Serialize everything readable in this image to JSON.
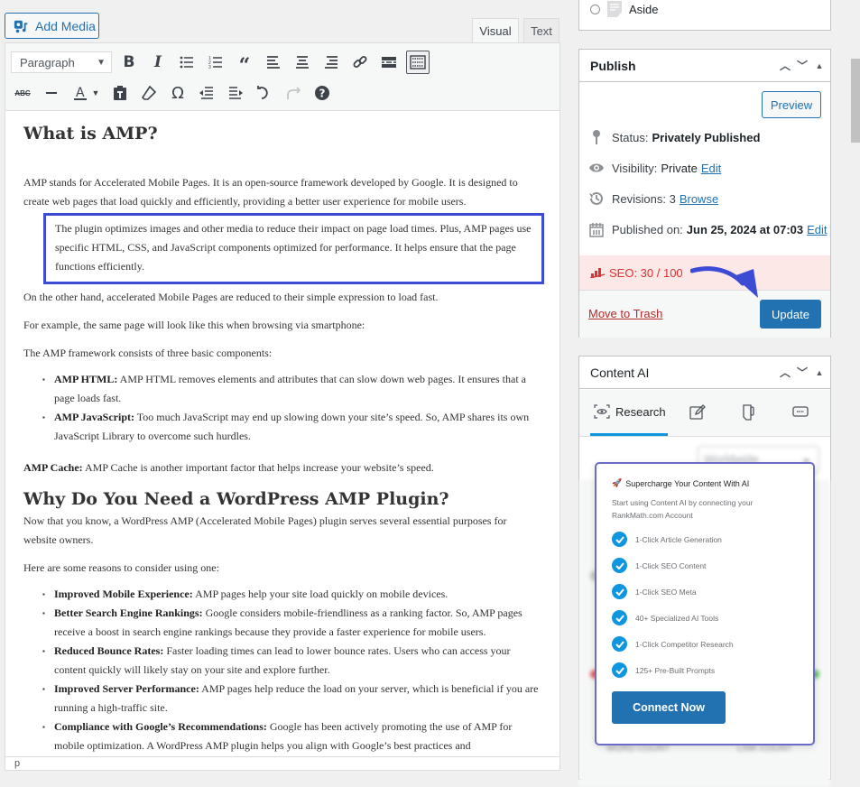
{
  "toolbar": {
    "add_media": "Add Media",
    "tab_visual": "Visual",
    "tab_text": "Text",
    "format_select": "Paragraph",
    "row1_buttons": [
      "bold-icon",
      "italic-icon",
      "bullet-list-icon",
      "numbered-list-icon",
      "blockquote-icon",
      "align-left-icon",
      "align-center-icon",
      "align-right-icon",
      "link-icon",
      "read-more-icon",
      "toolbar-toggle-icon"
    ],
    "row2_buttons": [
      "strikethrough-icon",
      "horizontal-line-icon",
      "text-color-icon",
      "paste-text-icon",
      "clear-formatting-icon",
      "special-character-icon",
      "outdent-icon",
      "indent-icon",
      "undo-icon",
      "redo-icon",
      "help-icon"
    ]
  },
  "content": {
    "h1": "What is AMP?",
    "p1": "AMP stands for Accelerated Mobile Pages. It is an open-source framework developed by Google. It is designed to create web pages that load quickly and efficiently, providing a better user experience for mobile users.",
    "highlight": "The plugin optimizes images and other media to reduce their impact on page load times. Plus, AMP pages use specific HTML, CSS, and JavaScript components optimized for performance. It helps ensure that the page functions efficiently.",
    "p2": "On the other hand, accelerated Mobile Pages are reduced to their simple expression to load fast.",
    "p3": "For example, the same page will look like this when browsing via smartphone:",
    "p4": "The AMP framework consists of three basic components:",
    "list1": [
      {
        "term": "AMP HTML:",
        "text": " AMP HTML removes elements and attributes that can slow down web pages. It ensures that a page loads fast."
      },
      {
        "term": "AMP JavaScript:",
        "text": " Too much JavaScript may end up slowing down your site’s speed. So, AMP shares its own JavaScript Library to overcome such hurdles."
      }
    ],
    "cache_term": "AMP Cache:",
    "cache_text": " AMP Cache is another important factor that helps increase your website’s speed.",
    "h2": "Why Do You Need a WordPress AMP Plugin?",
    "p5": "Now that you know, a WordPress AMP (Accelerated Mobile Pages) plugin serves several essential purposes for website owners.",
    "p6": "Here are some reasons to consider using one:",
    "list2": [
      {
        "term": "Improved Mobile Experience:",
        "text": " AMP pages help your site load quickly on mobile devices."
      },
      {
        "term": "Better Search Engine Rankings:",
        "text": " Google considers mobile-friendliness as a ranking factor. So, AMP pages receive a boost in search engine rankings because they provide a faster experience for mobile users."
      },
      {
        "term": "Reduced Bounce Rates:",
        "text": " Faster loading times can lead to lower bounce rates. Users who can access your content quickly will likely stay on your site and explore further."
      },
      {
        "term": "Improved Server Performance:",
        "text": " AMP pages help reduce the load on your server, which is beneficial if you are running a high-traffic site."
      },
      {
        "term": "Compliance with Google’s Recommendations:",
        "text": " Google has been actively promoting the use of AMP for mobile optimization. A WordPress AMP plugin helps you align with Google’s best practices and"
      }
    ],
    "status_path": "p"
  },
  "format_box": {
    "option": "Aside"
  },
  "publish": {
    "title": "Publish",
    "preview": "Preview",
    "status_label": "Status:",
    "status_value": "Privately Published",
    "visibility_label": "Visibility:",
    "visibility_value": "Private",
    "visibility_edit": "Edit",
    "revisions_label": "Revisions:",
    "revisions_value": "3",
    "revisions_browse": "Browse",
    "published_label": "Published on:",
    "published_value": "Jun 25, 2024 at 07:03",
    "published_edit": "Edit",
    "seo": "SEO: 30 / 100",
    "trash": "Move to Trash",
    "update": "Update",
    "seo_color": "#dc3232"
  },
  "content_ai": {
    "title": "Content AI",
    "tab_research": "Research",
    "country_select": "Worldwide",
    "card_title": "Supercharge Your Content With AI",
    "card_desc": "Start using Content AI by connecting your RankMath.com Account",
    "features": [
      "1-Click Article Generation",
      "1-Click SEO Content",
      "1-Click SEO Meta",
      "40+ Specialized AI Tools",
      "1-Click Competitor Research",
      "125+ Pre-Built Prompts"
    ],
    "connect": "Connect Now",
    "blurred_labels": [
      "WORD COUNT",
      "LINK COUNT"
    ],
    "accent": "#0f96e0"
  }
}
